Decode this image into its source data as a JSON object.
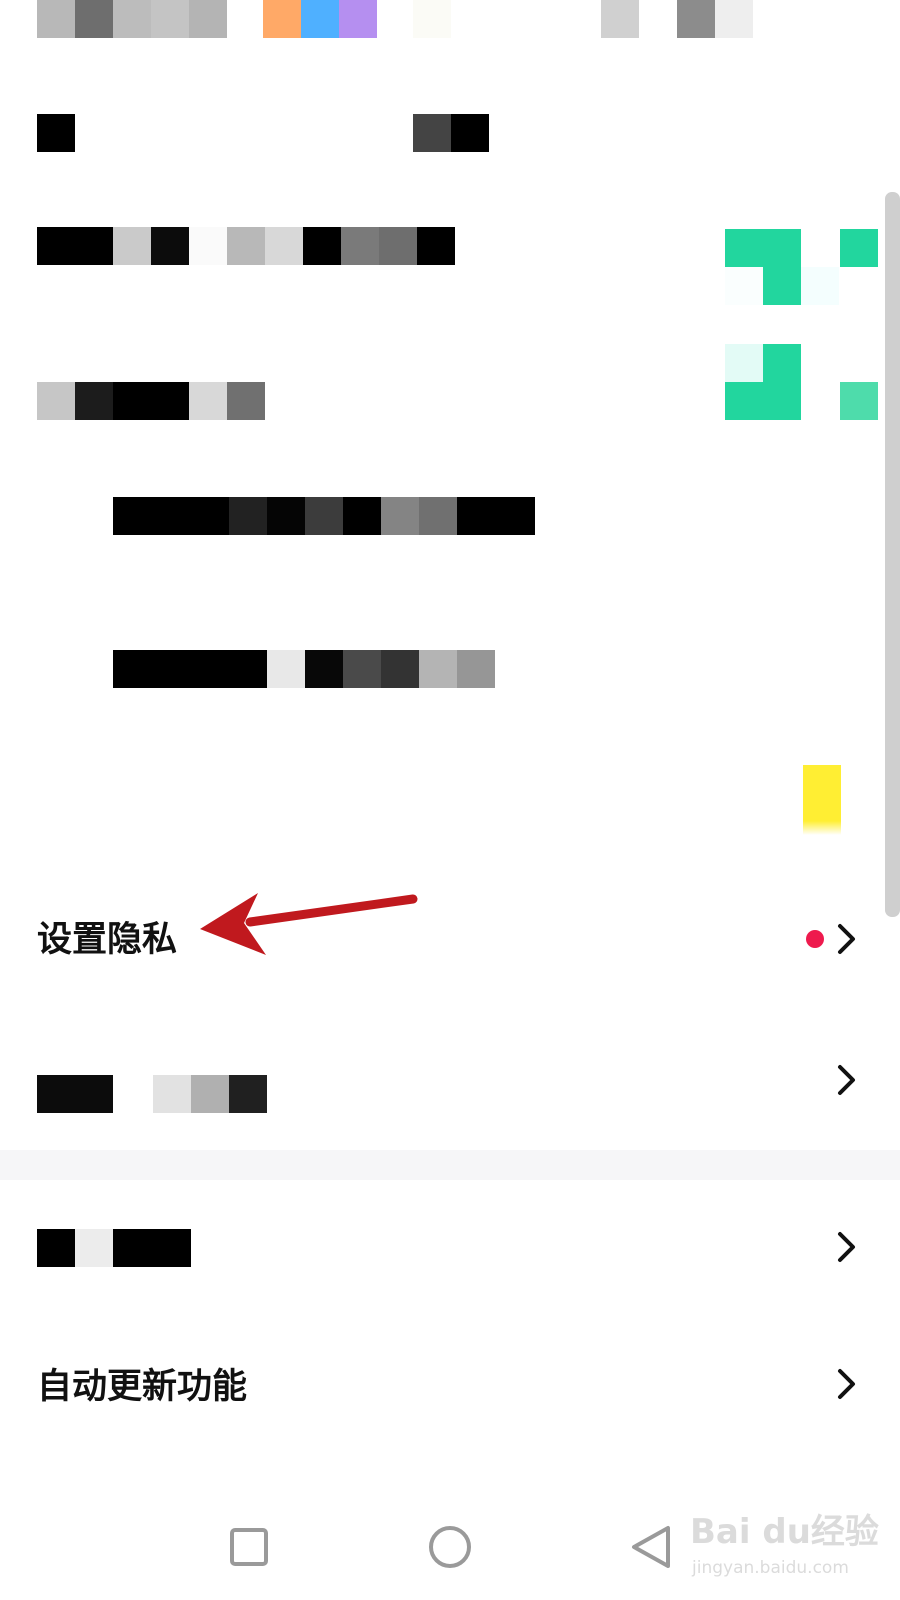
{
  "settings": {
    "privacy_label": "设置隐私",
    "auto_update_label": "自动更新功能"
  },
  "colors": {
    "accent_green": "#22D69E",
    "notification_dot": "#EE1A4D",
    "annotation_arrow": "#C0191E",
    "highlight_yellow": "#FFEE33"
  },
  "watermark": {
    "brand": "Bai du经验",
    "url": "jingyan.baidu.com"
  },
  "icons": {
    "chevron": "chevron-right-icon",
    "nav_recent": "square-icon",
    "nav_home": "circle-icon",
    "nav_back": "triangle-back-icon"
  }
}
